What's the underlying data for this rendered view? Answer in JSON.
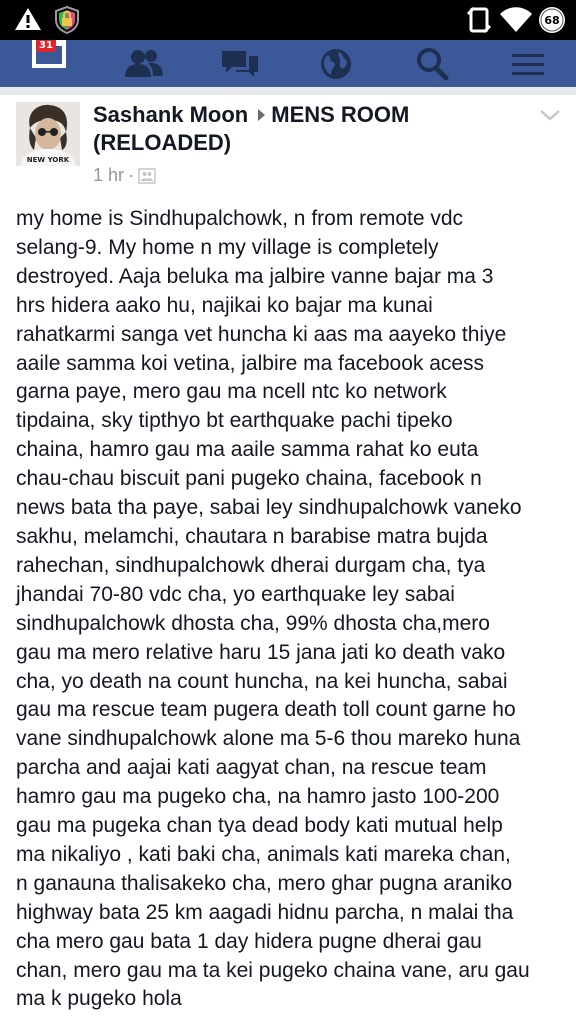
{
  "status_bar": {
    "battery_level": "68",
    "icons": [
      "warning-icon",
      "vpn-lock-icon",
      "screen-rotation-icon",
      "wifi-icon",
      "battery-icon"
    ]
  },
  "nav": {
    "notification_badge": "31",
    "items": [
      "calendar-icon",
      "friends-icon",
      "messages-icon",
      "globe-icon",
      "search-icon",
      "menu-icon"
    ]
  },
  "post": {
    "author": "Sashank Moon",
    "group": "MENS ROOM",
    "group_suffix": "(RELOADED)",
    "time": "1 hr",
    "dot": "·",
    "avatar_shirt_text": "NEW YORK",
    "lines": [
      "my home is Sindhupalchowk, n from remote vdc",
      "selang-9. My home n my village is completely",
      "destroyed. Aaja beluka ma jalbire vanne bajar ma 3",
      "hrs hidera aako hu, najikai ko bajar ma kunai",
      "rahatkarmi sanga vet huncha ki aas ma aayeko thiye",
      "aaile samma koi vetina, jalbire ma facebook acess",
      "garna paye, mero gau ma ncell ntc ko network",
      "tipdaina, sky tipthyo bt earthquake pachi tipeko",
      "chaina, hamro gau ma aaile samma rahat ko euta",
      "chau-chau biscuit pani pugeko chaina, facebook n",
      "news bata tha paye, sabai ley sindhupalchowk vaneko",
      "sakhu, melamchi, chautara n barabise matra bujda",
      "rahechan, sindhupalchowk dherai durgam cha, tya",
      "jhandai 70-80 vdc cha, yo earthquake ley sabai",
      "sindhupalchowk dhosta cha, 99% dhosta cha,mero",
      "gau ma mero relative haru 15 jana jati ko death vako",
      "cha, yo death na count huncha, na kei huncha, sabai",
      "gau ma rescue team pugera death toll count garne ho",
      "vane sindhupalchowk alone ma 5-6 thou mareko huna",
      "parcha and aajai kati aagyat chan, na rescue team",
      "hamro gau ma pugeko cha, na hamro jasto 100-200",
      "gau ma pugeka chan tya dead body kati mutual help",
      "ma nikaliyo , kati baki cha, animals kati mareka chan,",
      "n ganauna thalisakeko cha, mero ghar pugna araniko",
      "highway bata 25 km aagadi hidnu parcha, n malai tha",
      "cha mero gau bata 1 day hidera pugne dherai gau",
      "chan, mero gau ma ta kei pugeko chaina vane, aru gau",
      "ma k pugeko hola"
    ]
  },
  "colors": {
    "nav_bg": "#3b5998",
    "nav_icon": "#1e2f52",
    "badge": "#e0262d",
    "meta_text": "#9197a3",
    "body_text": "#141823"
  }
}
